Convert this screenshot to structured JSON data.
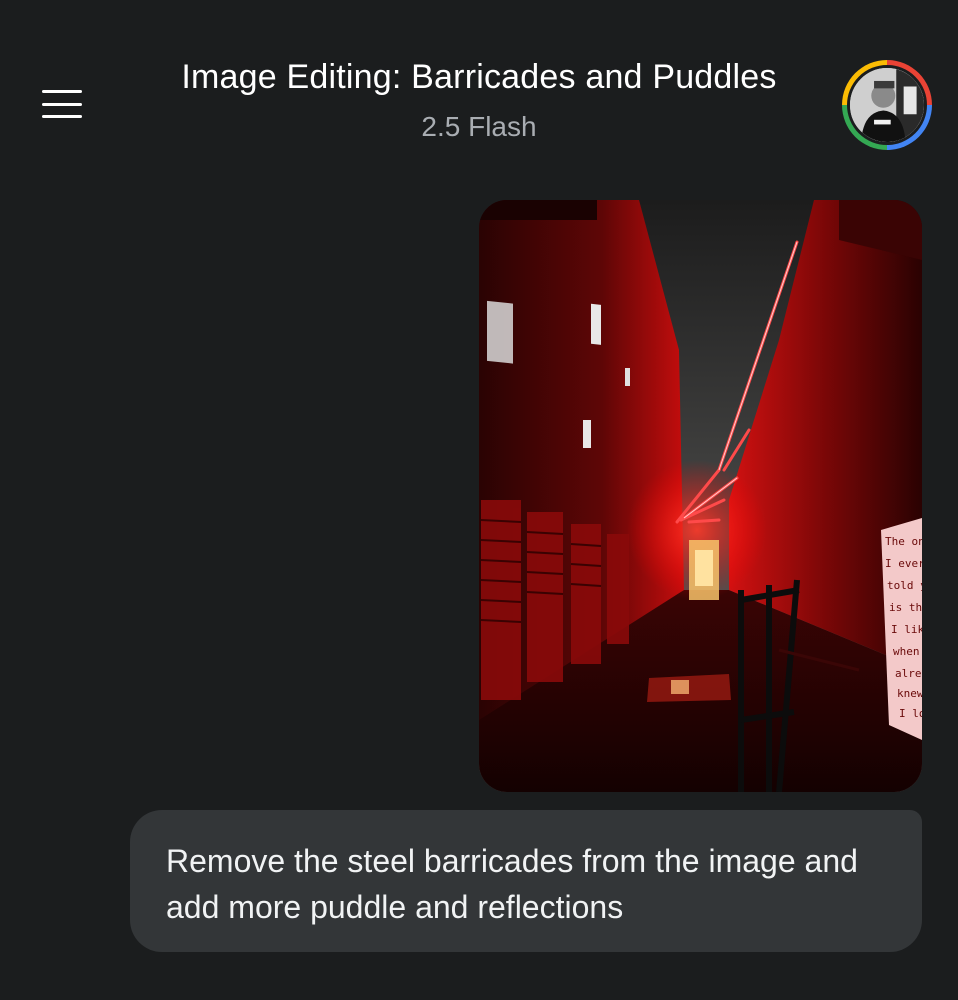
{
  "header": {
    "title": "Image Editing: Barricades and Puddles",
    "model": "2.5 Flash",
    "menu_icon": "hamburger-menu-icon",
    "avatar_ring_colors": [
      "#ea4335",
      "#4285f4",
      "#34a853",
      "#fbbc04"
    ]
  },
  "attachment": {
    "type": "image",
    "description_icon": "photo-attachment",
    "poster_text": [
      "The onl",
      "I ever",
      "told y",
      "is tha",
      "I like",
      "when",
      "alre",
      "knew",
      "I lo"
    ]
  },
  "message": {
    "text": "Remove the steel barricades from the image and add more puddle and reflections"
  },
  "colors": {
    "background": "#1b1d1e",
    "bubble": "#333638",
    "neon": "#ff2a2a"
  }
}
